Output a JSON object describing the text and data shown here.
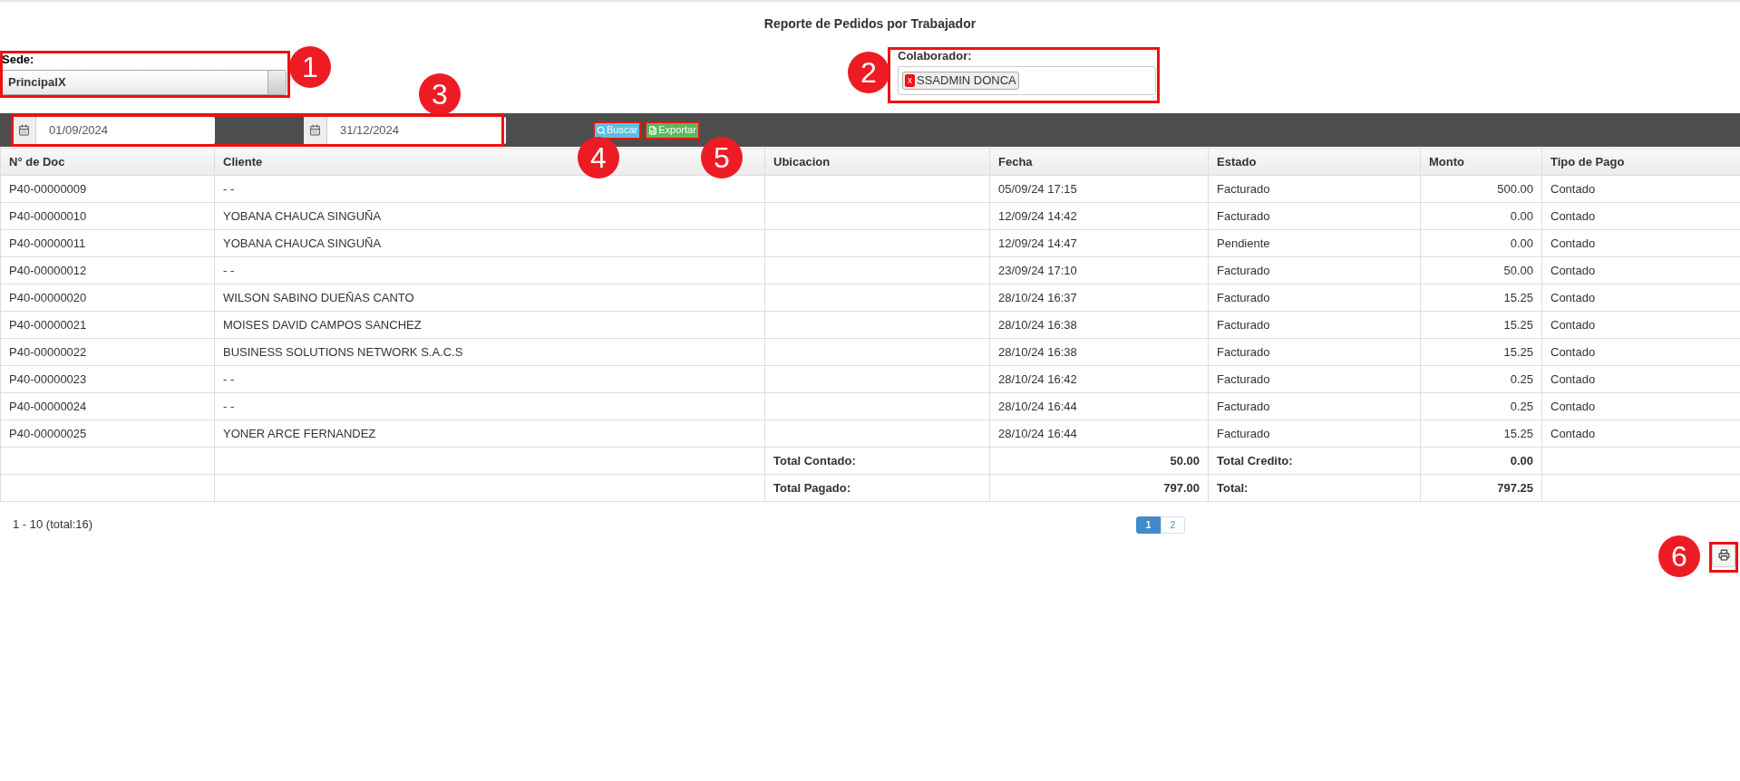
{
  "title": "Reporte de Pedidos por Trabajador",
  "sede": {
    "label": "Sede:",
    "value": "PrincipalX"
  },
  "colaborador": {
    "label": "Colaborador:",
    "tags": [
      {
        "remove": "x",
        "label": "SSADMIN DONCA"
      }
    ]
  },
  "date_range": [
    {
      "value": "01/09/2024"
    },
    {
      "value": "31/12/2024"
    }
  ],
  "buttons": [
    {
      "kind": "search",
      "label": "Buscar"
    },
    {
      "kind": "export",
      "label": "Exportar"
    }
  ],
  "table": {
    "columns": [
      "N° de Doc",
      "Cliente",
      "Ubicacion",
      "Fecha",
      "Estado",
      "Monto",
      "Tipo de Pago"
    ],
    "rows": [
      [
        "P40-00000009",
        "- -",
        "",
        "05/09/24 17:15",
        "Facturado",
        "500.00",
        "Contado"
      ],
      [
        "P40-00000010",
        "YOBANA CHAUCA SINGUÑA",
        "",
        "12/09/24 14:42",
        "Facturado",
        "0.00",
        "Contado"
      ],
      [
        "P40-00000011",
        "YOBANA CHAUCA SINGUÑA",
        "",
        "12/09/24 14:47",
        "Pendiente",
        "0.00",
        "Contado"
      ],
      [
        "P40-00000012",
        "- -",
        "",
        "23/09/24 17:10",
        "Facturado",
        "50.00",
        "Contado"
      ],
      [
        "P40-00000020",
        "WILSON SABINO DUEÑAS CANTO",
        "",
        "28/10/24 16:37",
        "Facturado",
        "15.25",
        "Contado"
      ],
      [
        "P40-00000021",
        "MOISES DAVID CAMPOS SANCHEZ",
        "",
        "28/10/24 16:38",
        "Facturado",
        "15.25",
        "Contado"
      ],
      [
        "P40-00000022",
        "BUSINESS SOLUTIONS NETWORK S.A.C.S",
        "",
        "28/10/24 16:38",
        "Facturado",
        "15.25",
        "Contado"
      ],
      [
        "P40-00000023",
        "- -",
        "",
        "28/10/24 16:42",
        "Facturado",
        "0.25",
        "Contado"
      ],
      [
        "P40-00000024",
        "- -",
        "",
        "28/10/24 16:44",
        "Facturado",
        "0.25",
        "Contado"
      ],
      [
        "P40-00000025",
        "YONER ARCE FERNANDEZ",
        "",
        "28/10/24 16:44",
        "Facturado",
        "15.25",
        "Contado"
      ]
    ],
    "totals": [
      {
        "label_1": "Total Contado:",
        "value_1": "50.00",
        "label_2": "Total Credito:",
        "value_2": "0.00"
      },
      {
        "label_1": "Total Pagado:",
        "value_1": "797.00",
        "label_2": "Total:",
        "value_2": "797.25"
      }
    ]
  },
  "pagination": {
    "summary": "1 - 10 (total:16)",
    "pages": [
      {
        "label": "1",
        "selected": true
      },
      {
        "label": "2",
        "selected": false
      }
    ]
  },
  "callouts": [
    "1",
    "2",
    "3",
    "4",
    "5",
    "6"
  ]
}
